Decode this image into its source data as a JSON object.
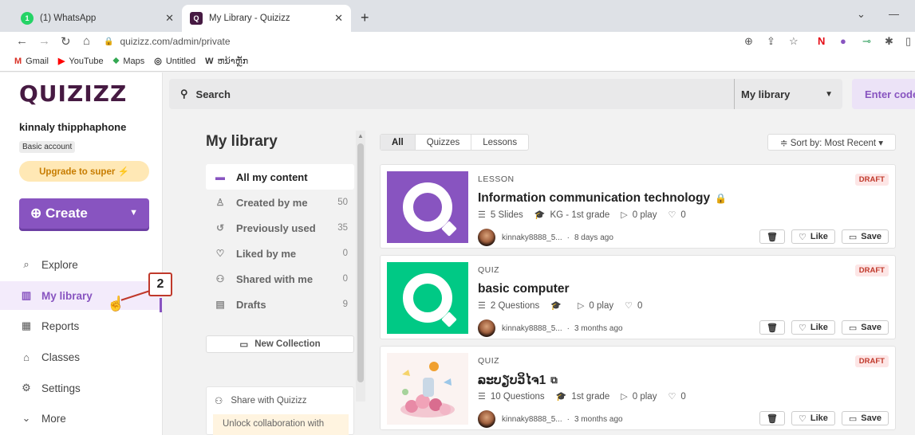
{
  "browser": {
    "tabs": [
      {
        "title": "(1) WhatsApp",
        "favicon_color": "#25d366",
        "favicon_text": "1"
      },
      {
        "title": "My Library - Quizizz",
        "favicon_color": "#461a42",
        "favicon_text": "Q"
      }
    ],
    "url": "quizizz.com/admin/private",
    "bookmarks": [
      {
        "label": "Gmail",
        "icon_text": "M",
        "color": "#d93025"
      },
      {
        "label": "YouTube",
        "icon_text": "▶",
        "color": "#ff0000"
      },
      {
        "label": "Maps",
        "icon_text": "⬥",
        "color": "#34a853"
      },
      {
        "label": "Untitled",
        "icon_text": "◎",
        "color": "#333333"
      },
      {
        "label": "ຫນ້າຫຼັກ",
        "icon_text": "W",
        "color": "#111111"
      }
    ]
  },
  "sidebar": {
    "logo": "QUIZIZZ",
    "username": "kinnaly thipphaphone",
    "account_type": "Basic account",
    "upgrade_label": "Upgrade to super ⚡",
    "create_label": "⊕ Create",
    "nav": [
      {
        "label": "Explore",
        "icon": "explore-icon",
        "glyph": "⌕"
      },
      {
        "label": "My library",
        "icon": "library-icon",
        "glyph": "▥"
      },
      {
        "label": "Reports",
        "icon": "reports-icon",
        "glyph": "▦"
      },
      {
        "label": "Classes",
        "icon": "classes-icon",
        "glyph": "⌂"
      },
      {
        "label": "Settings",
        "icon": "gear-icon",
        "glyph": "⚙"
      },
      {
        "label": "More",
        "icon": "chevron-down-icon",
        "glyph": "⌄"
      }
    ],
    "callout_number": "2"
  },
  "topbar": {
    "search_label": "Search",
    "scope_label": "My library",
    "enter_code_label": "Enter code"
  },
  "library": {
    "title": "My library",
    "menu": [
      {
        "label": "All my content",
        "count": "",
        "glyph": "▬"
      },
      {
        "label": "Created by me",
        "count": "50",
        "glyph": "♙"
      },
      {
        "label": "Previously used",
        "count": "35",
        "glyph": "↺"
      },
      {
        "label": "Liked by me",
        "count": "0",
        "glyph": "♡"
      },
      {
        "label": "Shared with me",
        "count": "0",
        "glyph": "⚇"
      },
      {
        "label": "Drafts",
        "count": "9",
        "glyph": "▤"
      }
    ],
    "new_collection_label": "New Collection",
    "share_title": "Share with Quizizz",
    "share_body": "Unlock collaboration with"
  },
  "filters": {
    "tabs": [
      "All",
      "Quizzes",
      "Lessons"
    ],
    "sort_label": "≑ Sort by: Most Recent ▾"
  },
  "cards": [
    {
      "type": "LESSON",
      "status": "DRAFT",
      "title": "Information communication technology",
      "title_icon": "🔒",
      "count": "5 Slides",
      "grade": "KG - 1st grade",
      "plays": "0 play",
      "likes": "0",
      "author": "kinnaky8888_5...",
      "time": "8 days ago"
    },
    {
      "type": "QUIZ",
      "status": "DRAFT",
      "title": "basic computer",
      "title_icon": "",
      "count": "2 Questions",
      "grade": "",
      "plays": "0 play",
      "likes": "0",
      "author": "kinnaky8888_5...",
      "time": "3 months ago"
    },
    {
      "type": "QUIZ",
      "status": "DRAFT",
      "title": "ລະບຽບວິໄຈ1",
      "title_icon": "⧉",
      "count": "10 Questions",
      "grade": "1st grade",
      "plays": "0 play",
      "likes": "0",
      "author": "kinnaky8888_5...",
      "time": "3 months ago"
    }
  ],
  "card_actions": {
    "like_label": "Like",
    "save_label": "Save"
  },
  "colors": {
    "brand_purple": "#8854c0",
    "quiz_green": "#00c985",
    "draft_red": "#c0392b"
  }
}
